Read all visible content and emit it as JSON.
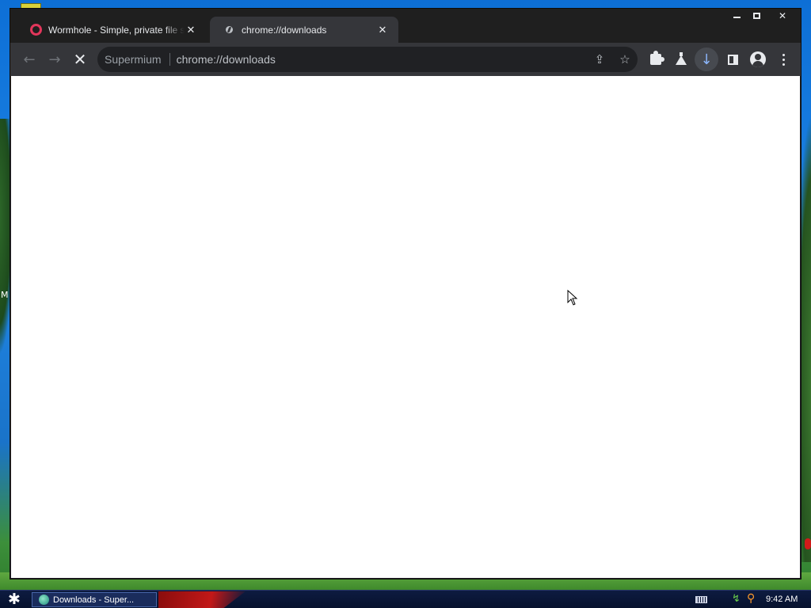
{
  "desktop": {
    "side_letter": "M"
  },
  "window": {
    "controls": {
      "minimize": "minimize",
      "maximize": "maximize",
      "close": "close"
    },
    "tabs": [
      {
        "title": "Wormhole - Simple, private file sharing",
        "close": "✕",
        "active": false
      },
      {
        "title": "chrome://downloads",
        "close": "✕",
        "active": true
      }
    ],
    "toolbar": {
      "back": "←",
      "forward": "→",
      "stop": "✕",
      "omnibox": {
        "chip": "Supermium",
        "url": "chrome://downloads"
      },
      "share": "⇪",
      "bookmark": "☆",
      "download": "↓"
    }
  },
  "taskbar": {
    "start": "✱",
    "task_button_label": "Downloads - Super...",
    "tray_network": "↯",
    "tray_search": "⚲",
    "clock": "9:42 AM"
  }
}
